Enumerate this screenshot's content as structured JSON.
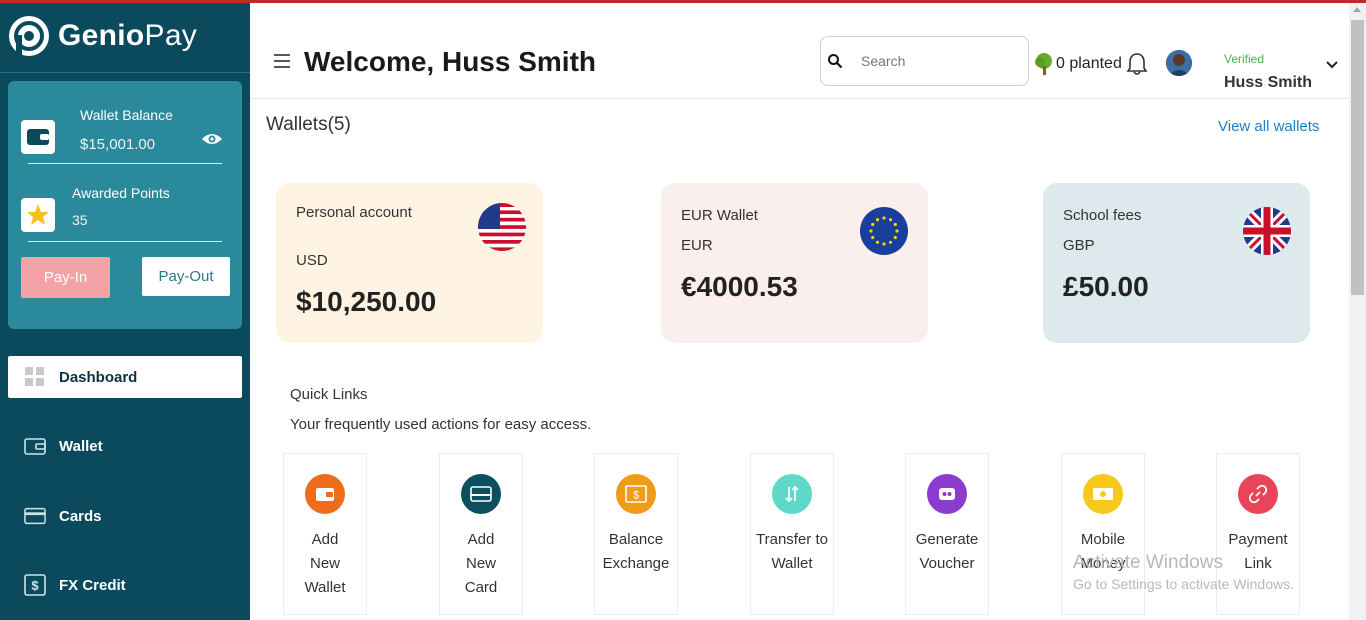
{
  "app": {
    "brand_bold": "Genio",
    "brand_light": "Pay"
  },
  "sidebar": {
    "wallet_balance_label": "Wallet Balance",
    "wallet_balance_value": "$15,001.00",
    "awarded_points_label": "Awarded Points",
    "awarded_points_value": "35",
    "pay_in_label": "Pay-In",
    "pay_out_label": "Pay-Out",
    "nav": [
      {
        "label": "Dashboard",
        "icon": "grid-icon"
      },
      {
        "label": "Wallet",
        "icon": "wallet-icon"
      },
      {
        "label": "Cards",
        "icon": "card-icon"
      },
      {
        "label": "FX Credit",
        "icon": "dollar-icon"
      }
    ]
  },
  "header": {
    "welcome": "Welcome, Huss Smith",
    "search_placeholder": "Search",
    "planted": "0 planted",
    "verified": "Verified",
    "username": "Huss Smith"
  },
  "wallets": {
    "title": "Wallets(5)",
    "view_all": "View all wallets",
    "items": [
      {
        "name": "Personal account",
        "currency": "USD",
        "balance": "$10,250.00",
        "flag": "us-flag-icon",
        "bg": "#fff4e3"
      },
      {
        "name": "EUR Wallet",
        "currency": "EUR",
        "balance": "€4000.53",
        "flag": "eu-flag-icon",
        "bg": "#fbefee"
      },
      {
        "name": "School fees",
        "currency": "GBP",
        "balance": "£50.00",
        "flag": "uk-flag-icon",
        "bg": "#dde9ed"
      }
    ]
  },
  "quick_links": {
    "title": "Quick Links",
    "subtitle": "Your frequently used actions for easy access.",
    "items": [
      {
        "label": "Add New Wallet",
        "icon": "wallet-icon",
        "color": "#ef6c1a"
      },
      {
        "label": "Add New Card",
        "icon": "card-icon",
        "color": "#0d4f5e"
      },
      {
        "label": "Balance Exchange",
        "icon": "exchange-icon",
        "color": "#f29b18"
      },
      {
        "label": "Transfer to Wallet",
        "icon": "transfer-icon",
        "color": "#5fd8c8"
      },
      {
        "label": "Generate Voucher",
        "icon": "voucher-icon",
        "color": "#8b3ccf"
      },
      {
        "label": "Mobile Money",
        "icon": "money-icon",
        "color": "#f7c91a"
      },
      {
        "label": "Payment Link",
        "icon": "link-icon",
        "color": "#e8445a"
      }
    ]
  },
  "watermark": {
    "line1": "Activate Windows",
    "line2": "Go to Settings to activate Windows."
  }
}
